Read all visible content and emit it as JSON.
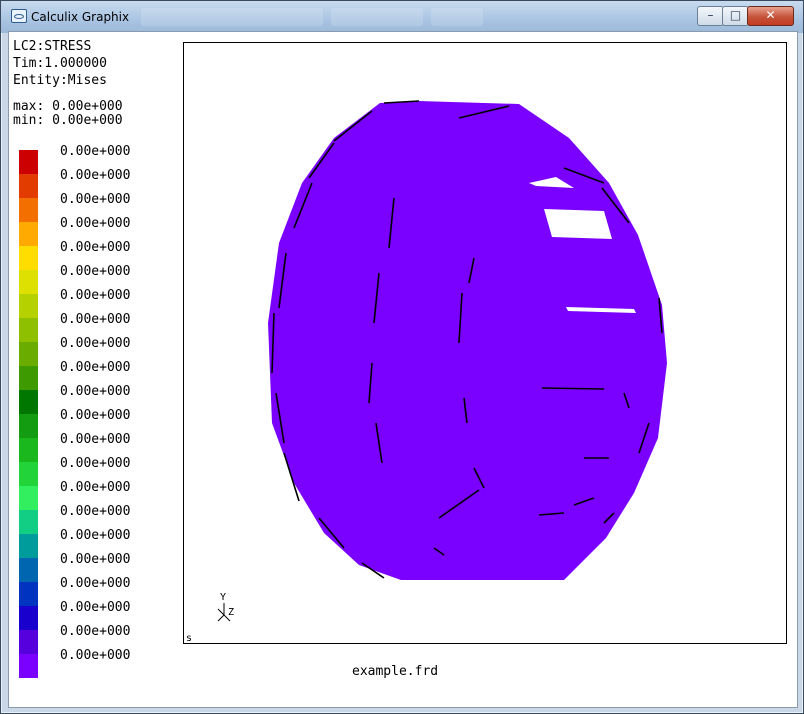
{
  "window": {
    "title": "Calculix Graphix"
  },
  "buttons": {
    "minimize": "–",
    "maximize": "□",
    "close": "✕"
  },
  "info": {
    "loadcase": "LC2:STRESS",
    "time": "Tim:1.000000",
    "entity": "Entity:Mises",
    "max": "max: 0.00e+000",
    "min": "min: 0.00e+000"
  },
  "scale": {
    "colors": [
      "#cc0000",
      "#e23c00",
      "#f36f00",
      "#ffaa00",
      "#ffdd00",
      "#dde000",
      "#b6d100",
      "#8fc000",
      "#6aad00",
      "#3d9a00",
      "#007700",
      "#139b11",
      "#1ab81d",
      "#22d43a",
      "#31ef5f",
      "#12ce84",
      "#009c9c",
      "#0066b0",
      "#0033c0",
      "#1a00cc",
      "#5500dd",
      "#7a00ff"
    ],
    "labels": [
      "0.00e+000",
      "0.00e+000",
      "0.00e+000",
      "0.00e+000",
      "0.00e+000",
      "0.00e+000",
      "0.00e+000",
      "0.00e+000",
      "0.00e+000",
      "0.00e+000",
      "0.00e+000",
      "0.00e+000",
      "0.00e+000",
      "0.00e+000",
      "0.00e+000",
      "0.00e+000",
      "0.00e+000",
      "0.00e+000",
      "0.00e+000",
      "0.00e+000",
      "0.00e+000",
      "0.00e+000"
    ]
  },
  "viewport": {
    "model_color": "#7a00ff",
    "axis_y": "Y",
    "axis_z": "Z",
    "mode_char": "s"
  },
  "footer": {
    "filename": "example.frd"
  }
}
